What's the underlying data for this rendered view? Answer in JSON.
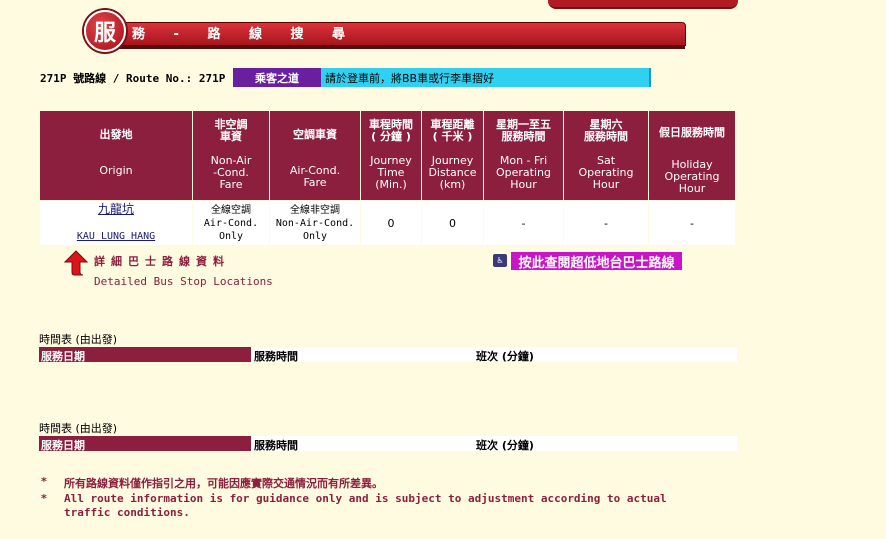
{
  "header": {
    "badge": "服",
    "title": "務 - 路 線 搜 尋"
  },
  "route": {
    "line": "271P 號路線 / Route No.: 271P"
  },
  "notice": {
    "label": "乘客之道",
    "message": "請於登車前，將BB車或行李車摺好"
  },
  "table": {
    "headers": [
      {
        "zh": "出發地",
        "en": "Origin"
      },
      {
        "zh": "非空調\n車資",
        "en": "Non-Air\n-Cond.\nFare"
      },
      {
        "zh": "空調車資",
        "en": "Air-Cond.\nFare"
      },
      {
        "zh": "車程時間\n( 分鐘 )",
        "en": "Journey\nTime\n(Min.)"
      },
      {
        "zh": "車程距離\n( 千米 )",
        "en": "Journey\nDistance\n(km)"
      },
      {
        "zh": "星期一至五\n服務時間",
        "en": "Mon - Fri\nOperating\nHour"
      },
      {
        "zh": "星期六\n服務時間",
        "en": "Sat\nOperating\nHour"
      },
      {
        "zh": "假日服務時間",
        "en": "Holiday\nOperating\nHour"
      }
    ],
    "row": {
      "origin_zh": "九龍坑",
      "origin_en": "KAU LUNG HANG",
      "nonair_fare": "全線空調\nAir-Cond.\nOnly",
      "air_fare": "全線非空調\nNon-Air-Cond.\nOnly",
      "journey_time": "0",
      "journey_distance": "0",
      "mon_fri": "-",
      "sat": "-",
      "holiday": "-"
    }
  },
  "detail": {
    "zh": "詳細巴士路線資料",
    "en": "Detailed Bus Stop Locations"
  },
  "low_floor": {
    "icon": "wheelchair-icon",
    "label": "按此查閱超低地台巴士路線"
  },
  "timetables": [
    {
      "label": "時間表 (由出發)",
      "col1": "服務日期",
      "col2": "服務時間",
      "col3": "班次 (分鐘)"
    },
    {
      "label": "時間表 (由出發)",
      "col1": "服務日期",
      "col2": "服務時間",
      "col3": "班次 (分鐘)"
    }
  ],
  "footnotes": {
    "mark": "*",
    "zh": "所有路線資料僅作指引之用，可能因應實際交通情況而有所差異。",
    "en1": "All route information is for guidance only and is subject to adjustment according to actual",
    "en2": "traffic conditions."
  },
  "colors": {
    "accent": "#8c1f3e",
    "banner": "#b01c22",
    "notice_label": "#6a1fa0",
    "notice_bg": "#30d0f0",
    "low_floor": "#c815c8",
    "background": "#fffbe1"
  }
}
